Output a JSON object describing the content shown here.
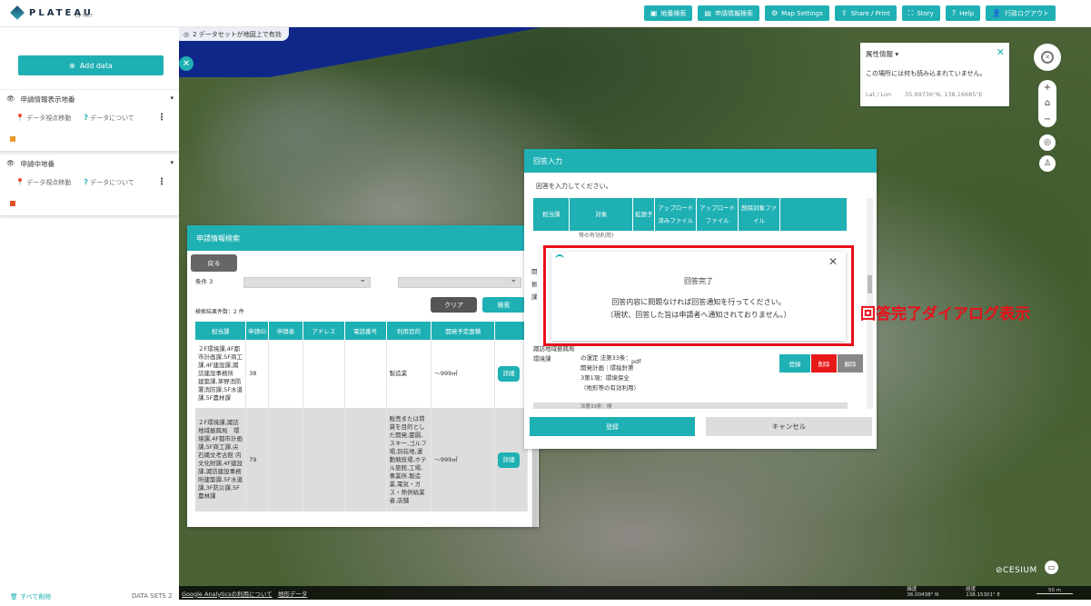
{
  "header": {
    "logo_text": "PLATEAU",
    "logo_sub": "by MLIT",
    "nav": [
      {
        "icon": "▣",
        "label": "地番検索"
      },
      {
        "icon": "▤",
        "label": "申請情報検索"
      },
      {
        "icon": "⚙",
        "label": "Map Settings"
      },
      {
        "icon": "⇪",
        "label": "Share / Print"
      },
      {
        "icon": "⛶",
        "label": "Story"
      },
      {
        "icon": "?",
        "label": "Help"
      },
      {
        "icon": "👤",
        "label": "行政ログアウト"
      }
    ]
  },
  "sidebar": {
    "add_data": "Add data",
    "layers": [
      {
        "eye": "👁",
        "name": "申請情報表示地番",
        "caret": "▾",
        "move": "データ視点移動",
        "about": "データについて",
        "swatch": "#e89a2c"
      },
      {
        "eye": "👁",
        "name": "申請中地番",
        "caret": "▾",
        "move": "データ視点移動",
        "about": "データについて",
        "swatch": "#e0502a"
      }
    ],
    "remove_all": "すべて削除",
    "datasets": "DATA SETS 2"
  },
  "map": {
    "status": "2 データセットが地図上で有効",
    "footer_links": [
      "Google Analyticsの利用について",
      "地形データ"
    ],
    "lat_label": "緯度",
    "lat_value": "36.00438° N",
    "lon_label": "経度",
    "lon_value": "138.15301° E",
    "scale": "50 m",
    "cesium": "CESIUM"
  },
  "feature": {
    "title": "属性情報",
    "message": "この場所には何も読み込まれていません。",
    "latlon_label": "Lat / Lon",
    "latlon_value": "35.99736°N, 138.16685°E"
  },
  "search": {
    "title": "申請情報検索",
    "back": "戻る",
    "cond_label": "条件 3",
    "clear": "クリア",
    "search": "検索",
    "result_count": "検索結果件数：2 件",
    "columns": [
      "担当課",
      "申請ID",
      "申請者",
      "アドレス",
      "電話番号",
      "利用目的",
      "開発予定面積",
      ""
    ],
    "rows": [
      {
        "dept": "２F環境課,4F都市計画課,5F商工課,4F建設課,諏訪建設事務所　建築課,茅野消防署消防課,5F水道課,5F農林課",
        "id": "38",
        "purpose": "製造業",
        "area": "～999㎡",
        "detail": "詳細"
      },
      {
        "dept": "２F環境課,諏訪地域振興局　環境課,4F都市計画課,5F商工課,尖石縄文考古館 内　文化財課,4F建設課,諏訪建設事務所建築課,5F水道課,3F防災課,5F農林課",
        "id": "79",
        "purpose": "販売または賃貸を目的とした開発,霊園,スキー,ゴルフ場,別荘地,運動競技場,ホテル旅館,工場,事業所,製造業,電気・ガス・熱供給業者,店舗",
        "area": "～999㎡",
        "detail": "詳細"
      }
    ]
  },
  "answer": {
    "title": "回答入力",
    "prompt": "回答を入力してください。",
    "columns": [
      "担当課",
      "対象",
      "拡張子",
      "アップロード済みファイル",
      "アップロードファイル",
      "削除対象ファイル",
      ""
    ],
    "top_row_text": "等の有効利用)",
    "left_cut": [
      "開",
      "振",
      "課"
    ],
    "lower_dept": "諏訪地域振興局　環境課",
    "lower_target": "の運定 法第33条：開発計画｜環指針第3第1項：環境保全（地形等の有効利用）",
    "lower_ext": "pdf",
    "bottom_strip": "法第33条：開",
    "btn_register": "登録",
    "btn_delete": "削除",
    "btn_release": "解除",
    "submit": "登録",
    "cancel": "キャンセル"
  },
  "done": {
    "title": "回答完了",
    "msg1": "回答内容に問題なければ回答通知を行ってください。",
    "msg2": "（現状、回答した旨は申請者へ通知されておりません。）"
  },
  "annotation": "回答完了ダイアログ表示",
  "colors": {
    "accent": "#1fb0b4",
    "danger": "#e8101a",
    "delete_red": "#e81818",
    "gray": "#666666"
  }
}
